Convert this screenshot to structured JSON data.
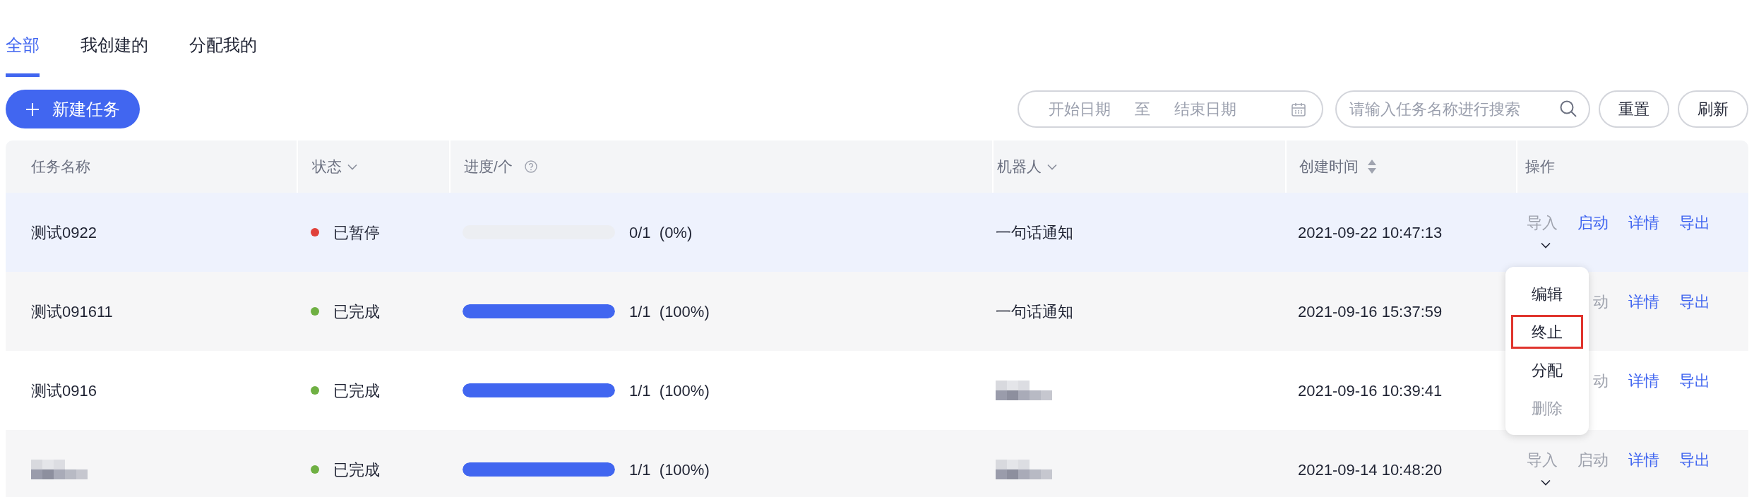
{
  "tabs": [
    {
      "label": "全部",
      "selected": true
    },
    {
      "label": "我创建的",
      "selected": false
    },
    {
      "label": "分配我的",
      "selected": false
    }
  ],
  "toolbar": {
    "new_button": "新建任务",
    "date_range": {
      "start_placeholder": "开始日期",
      "separator": "至",
      "end_placeholder": "结束日期"
    },
    "search": {
      "placeholder": "请输入任务名称进行搜索"
    },
    "buttons": [
      "重置",
      "刷新"
    ]
  },
  "table": {
    "columns": [
      {
        "label": "任务名称",
        "kind": "plain"
      },
      {
        "label": "状态",
        "kind": "filter"
      },
      {
        "label": "进度/个",
        "kind": "help"
      },
      {
        "label": "机器人",
        "kind": "filter"
      },
      {
        "label": "创建时间",
        "kind": "sort"
      },
      {
        "label": "操作",
        "kind": "plain"
      }
    ],
    "rows": [
      {
        "name": {
          "kind": "text",
          "text": "测试0922"
        },
        "status": "已暂停",
        "color": "#e0413a",
        "level": 0,
        "progress": "0/1  (0%)",
        "robot": {
          "kind": "text",
          "text": "一句话通知"
        },
        "created": "2021-09-22 10:47:13",
        "highlighted": true,
        "more": true,
        "actions": [
          {
            "label": "导入",
            "disabled": true
          },
          {
            "label": "启动",
            "disabled": false
          },
          {
            "label": "详情",
            "disabled": false
          },
          {
            "label": "导出",
            "disabled": false
          }
        ]
      },
      {
        "name": {
          "kind": "text",
          "text": "测试091611"
        },
        "status": "已完成",
        "color": "#6fb043",
        "level": 1,
        "progress": "1/1  (100%)",
        "robot": {
          "kind": "text",
          "text": "一句话通知"
        },
        "created": "2021-09-16 15:37:59",
        "highlighted": false,
        "more": false,
        "actions": [
          {
            "label": "动",
            "disabled": true
          },
          {
            "label": "详情",
            "disabled": false
          },
          {
            "label": "导出",
            "disabled": false
          }
        ]
      },
      {
        "name": {
          "kind": "text",
          "text": "测试0916"
        },
        "status": "已完成",
        "color": "#6fb043",
        "level": 1,
        "progress": "1/1  (100%)",
        "robot": {
          "kind": "blurred"
        },
        "created": "2021-09-16 10:39:41",
        "highlighted": false,
        "more": false,
        "actions": [
          {
            "label": "动",
            "disabled": true
          },
          {
            "label": "详情",
            "disabled": false
          },
          {
            "label": "导出",
            "disabled": false
          }
        ]
      },
      {
        "name": {
          "kind": "blurred"
        },
        "status": "已完成",
        "color": "#6fb043",
        "level": 1,
        "progress": "1/1  (100%)",
        "robot": {
          "kind": "blurred"
        },
        "created": "2021-09-14 10:48:20",
        "highlighted": false,
        "more": true,
        "actions": [
          {
            "label": "导入",
            "disabled": true
          },
          {
            "label": "启动",
            "disabled": true
          },
          {
            "label": "详情",
            "disabled": false
          },
          {
            "label": "导出",
            "disabled": false
          }
        ]
      }
    ]
  },
  "menu": {
    "items": [
      {
        "label": "编辑",
        "disabled": false,
        "outlined": false
      },
      {
        "label": "终止",
        "disabled": false,
        "outlined": true
      },
      {
        "label": "分配",
        "disabled": false,
        "outlined": false
      },
      {
        "label": "删除",
        "disabled": true,
        "outlined": false
      }
    ]
  }
}
